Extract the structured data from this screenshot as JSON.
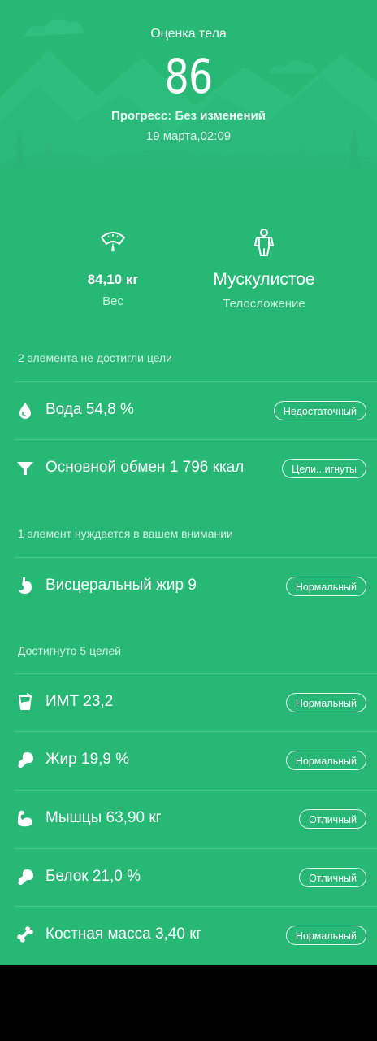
{
  "header": {
    "title": "Оценка тела",
    "score": "86",
    "progress": "Прогресс: Без изменений",
    "timestamp": "19 марта,02:09"
  },
  "stats": {
    "weight": {
      "value": "84,10 кг",
      "label": "Вес",
      "icon": "scale-icon"
    },
    "body_type": {
      "value": "Мускулистое",
      "label": "Телосложение",
      "icon": "body-figure-icon"
    }
  },
  "sections": [
    {
      "title": "2 элемента не достигли цели",
      "items": [
        {
          "label": "Вода 54,8 %",
          "badge": "Недостаточный",
          "icon": "water-drop-icon"
        },
        {
          "label": "Основной обмен 1 796 ккал",
          "badge": "Цели...игнуты",
          "icon": "funnel-icon"
        }
      ]
    },
    {
      "title": "1 элемент нуждается в вашем внимании",
      "items": [
        {
          "label": "Висцеральный жир 9",
          "badge": "Нормальный",
          "icon": "stomach-icon"
        }
      ]
    },
    {
      "title": "Достигнуто 5 целей",
      "items": [
        {
          "label": "ИМТ 23,2",
          "badge": "Нормальный",
          "icon": "beaker-icon"
        },
        {
          "label": "Жир 19,9 %",
          "badge": "Нормальный",
          "icon": "drumstick-icon"
        },
        {
          "label": "Мышцы 63,90 кг",
          "badge": "Отличный",
          "icon": "bicep-icon"
        },
        {
          "label": "Белок 21,0 %",
          "badge": "Отличный",
          "icon": "drumstick-icon"
        },
        {
          "label": "Костная масса 3,40 кг",
          "badge": "Нормальный",
          "icon": "bone-icon"
        }
      ]
    }
  ],
  "colors": {
    "background": "#26b874",
    "mountain_light": "#34c07f",
    "mountain_dark": "#2ab479"
  }
}
